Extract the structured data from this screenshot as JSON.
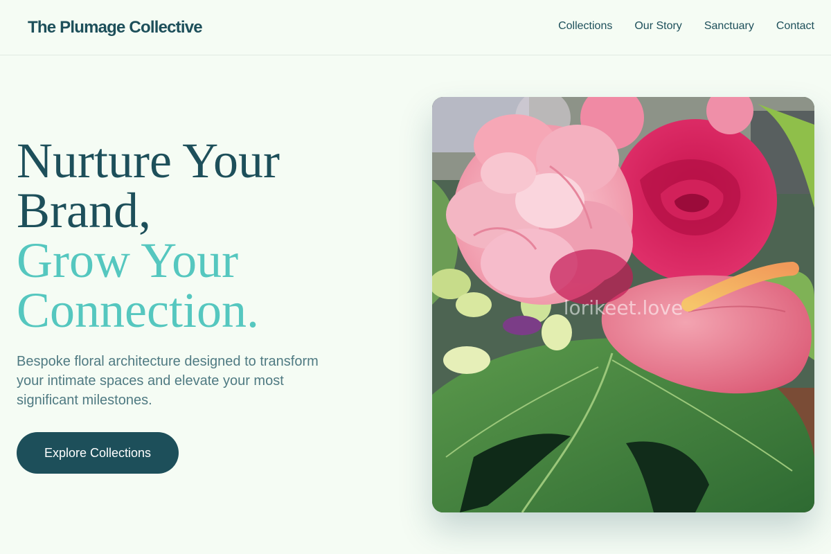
{
  "brand": {
    "name": "The Plumage Collective"
  },
  "nav": {
    "items": [
      {
        "label": "Collections"
      },
      {
        "label": "Our Story"
      },
      {
        "label": "Sanctuary"
      },
      {
        "label": "Contact"
      }
    ]
  },
  "hero": {
    "title_lines": [
      "Nurture Your",
      "Brand,"
    ],
    "accent_lines": [
      "Grow Your",
      "Connection."
    ],
    "subtitle": "Bespoke floral architecture designed to transform your intimate spaces and elevate your most significant milestones.",
    "cta_label": "Explore Collections",
    "image": {
      "subject": "pink flowers and monstera leaf arrangement",
      "watermark": "lorikeet.love"
    }
  },
  "colors": {
    "background": "#f5fcf4",
    "primary": "#1d4f5a",
    "accent": "#55c7bf",
    "muted_text": "#4f7a82"
  }
}
